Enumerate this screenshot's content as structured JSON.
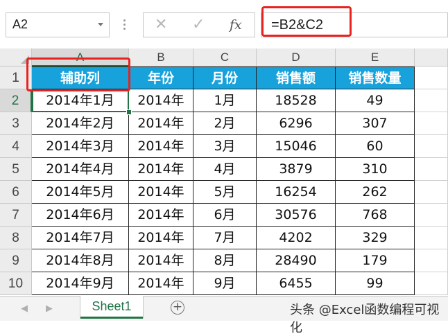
{
  "formula_bar": {
    "name_box": "A2",
    "cancel_icon": "✕",
    "enter_icon": "✓",
    "fx_label": "fx",
    "formula": "=B2&C2"
  },
  "columns": [
    "A",
    "B",
    "C",
    "D",
    "E"
  ],
  "rows": [
    "1",
    "2",
    "3",
    "4",
    "5",
    "6",
    "7",
    "8",
    "9",
    "10"
  ],
  "table": {
    "headers": [
      "辅助列",
      "年份",
      "月份",
      "销售额",
      "销售数量"
    ],
    "data": [
      [
        "2014年1月",
        "2014年",
        "1月",
        "18528",
        "49"
      ],
      [
        "2014年2月",
        "2014年",
        "2月",
        "6296",
        "307"
      ],
      [
        "2014年3月",
        "2014年",
        "3月",
        "15046",
        "60"
      ],
      [
        "2014年4月",
        "2014年",
        "4月",
        "3879",
        "310"
      ],
      [
        "2014年5月",
        "2014年",
        "5月",
        "16254",
        "262"
      ],
      [
        "2014年6月",
        "2014年",
        "6月",
        "30576",
        "768"
      ],
      [
        "2014年7月",
        "2014年",
        "7月",
        "4202",
        "329"
      ],
      [
        "2014年8月",
        "2014年",
        "8月",
        "28490",
        "179"
      ],
      [
        "2014年9月",
        "2014年",
        "9月",
        "6455",
        "99"
      ]
    ]
  },
  "sheet_tabs": [
    "Sheet1"
  ],
  "add_sheet_icon": "⊕",
  "watermark": "头条 @Excel函数编程可视化",
  "colors": {
    "header_fill": "#17a2dc",
    "accent_green": "#217346",
    "highlight_red": "#e8231f"
  }
}
